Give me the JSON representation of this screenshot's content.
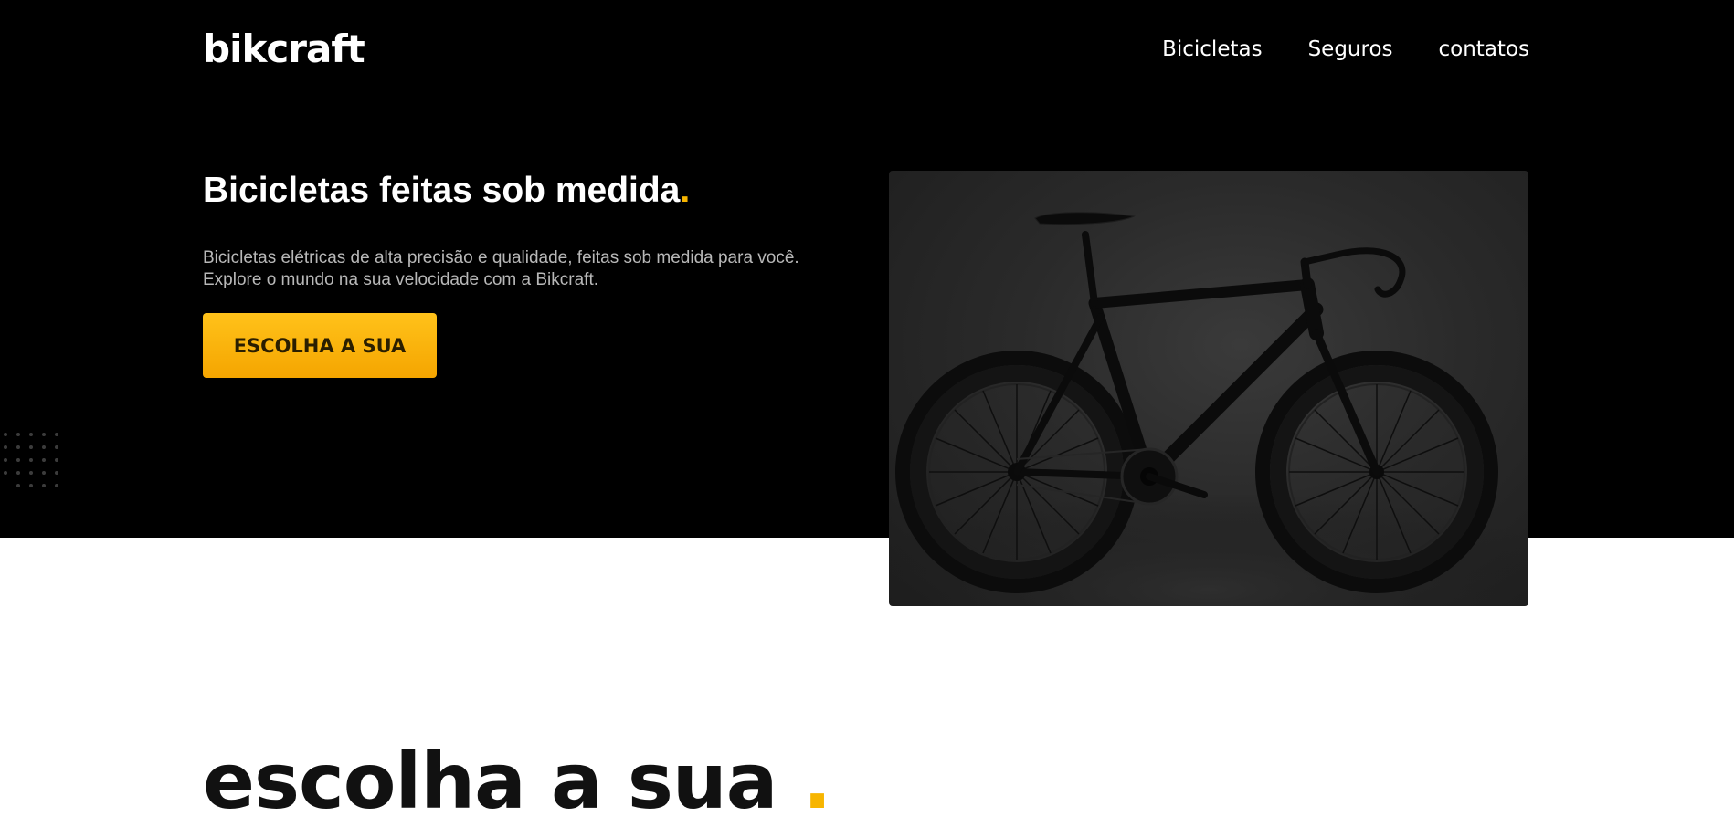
{
  "header": {
    "logo": "bikcraft",
    "nav": [
      "Bicicletas",
      "Seguros",
      "contatos"
    ]
  },
  "hero": {
    "title": "Bicicletas feitas sob medida",
    "title_dot": ".",
    "description_line1": "Bicicletas elétricas de alta precisão e qualidade, feitas sob medida para você.",
    "description_line2": "Explore o mundo na sua velocidade com a Bikcraft.",
    "cta_label": "ESCOLHA A SUA",
    "image_subject": "black road bicycle"
  },
  "section": {
    "title": "escolha a sua",
    "title_dot": "."
  },
  "colors": {
    "accent": "#f7b500",
    "hero_background": "#000000",
    "page_background": "#ffffff",
    "text_light": "#ffffff",
    "text_muted": "#b8b8b8",
    "text_dark": "#111111"
  }
}
